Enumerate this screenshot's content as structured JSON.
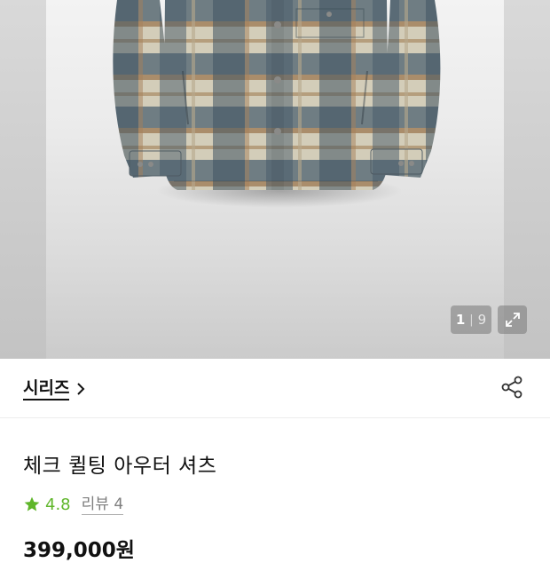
{
  "gallery": {
    "current": "1",
    "separator": "|",
    "total": "9"
  },
  "series": {
    "label": "시리즈"
  },
  "product": {
    "title": "체크 퀼팅 아우터 셔츠",
    "rating": "4.8",
    "reviews": "리뷰 4",
    "price": "399,000원"
  },
  "colors": {
    "rating_green": "#5fb62a",
    "text_primary": "#111111",
    "text_muted": "#7d7d7d"
  },
  "icons": {
    "series_chevron": "chevron-right-icon",
    "share": "share-icon",
    "expand": "expand-icon",
    "rating_star": "star-icon"
  }
}
